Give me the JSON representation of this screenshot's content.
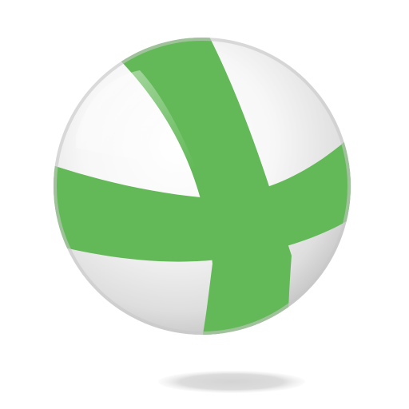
{
  "logo": {
    "icon": "green-cross-sphere-icon",
    "colors": {
      "band": "#63b958",
      "sphere_light": "#ffffff",
      "sphere_mid": "#e6e6e6",
      "sphere_dark": "#bdbdbd",
      "shadow": "#d9d9d9"
    }
  }
}
